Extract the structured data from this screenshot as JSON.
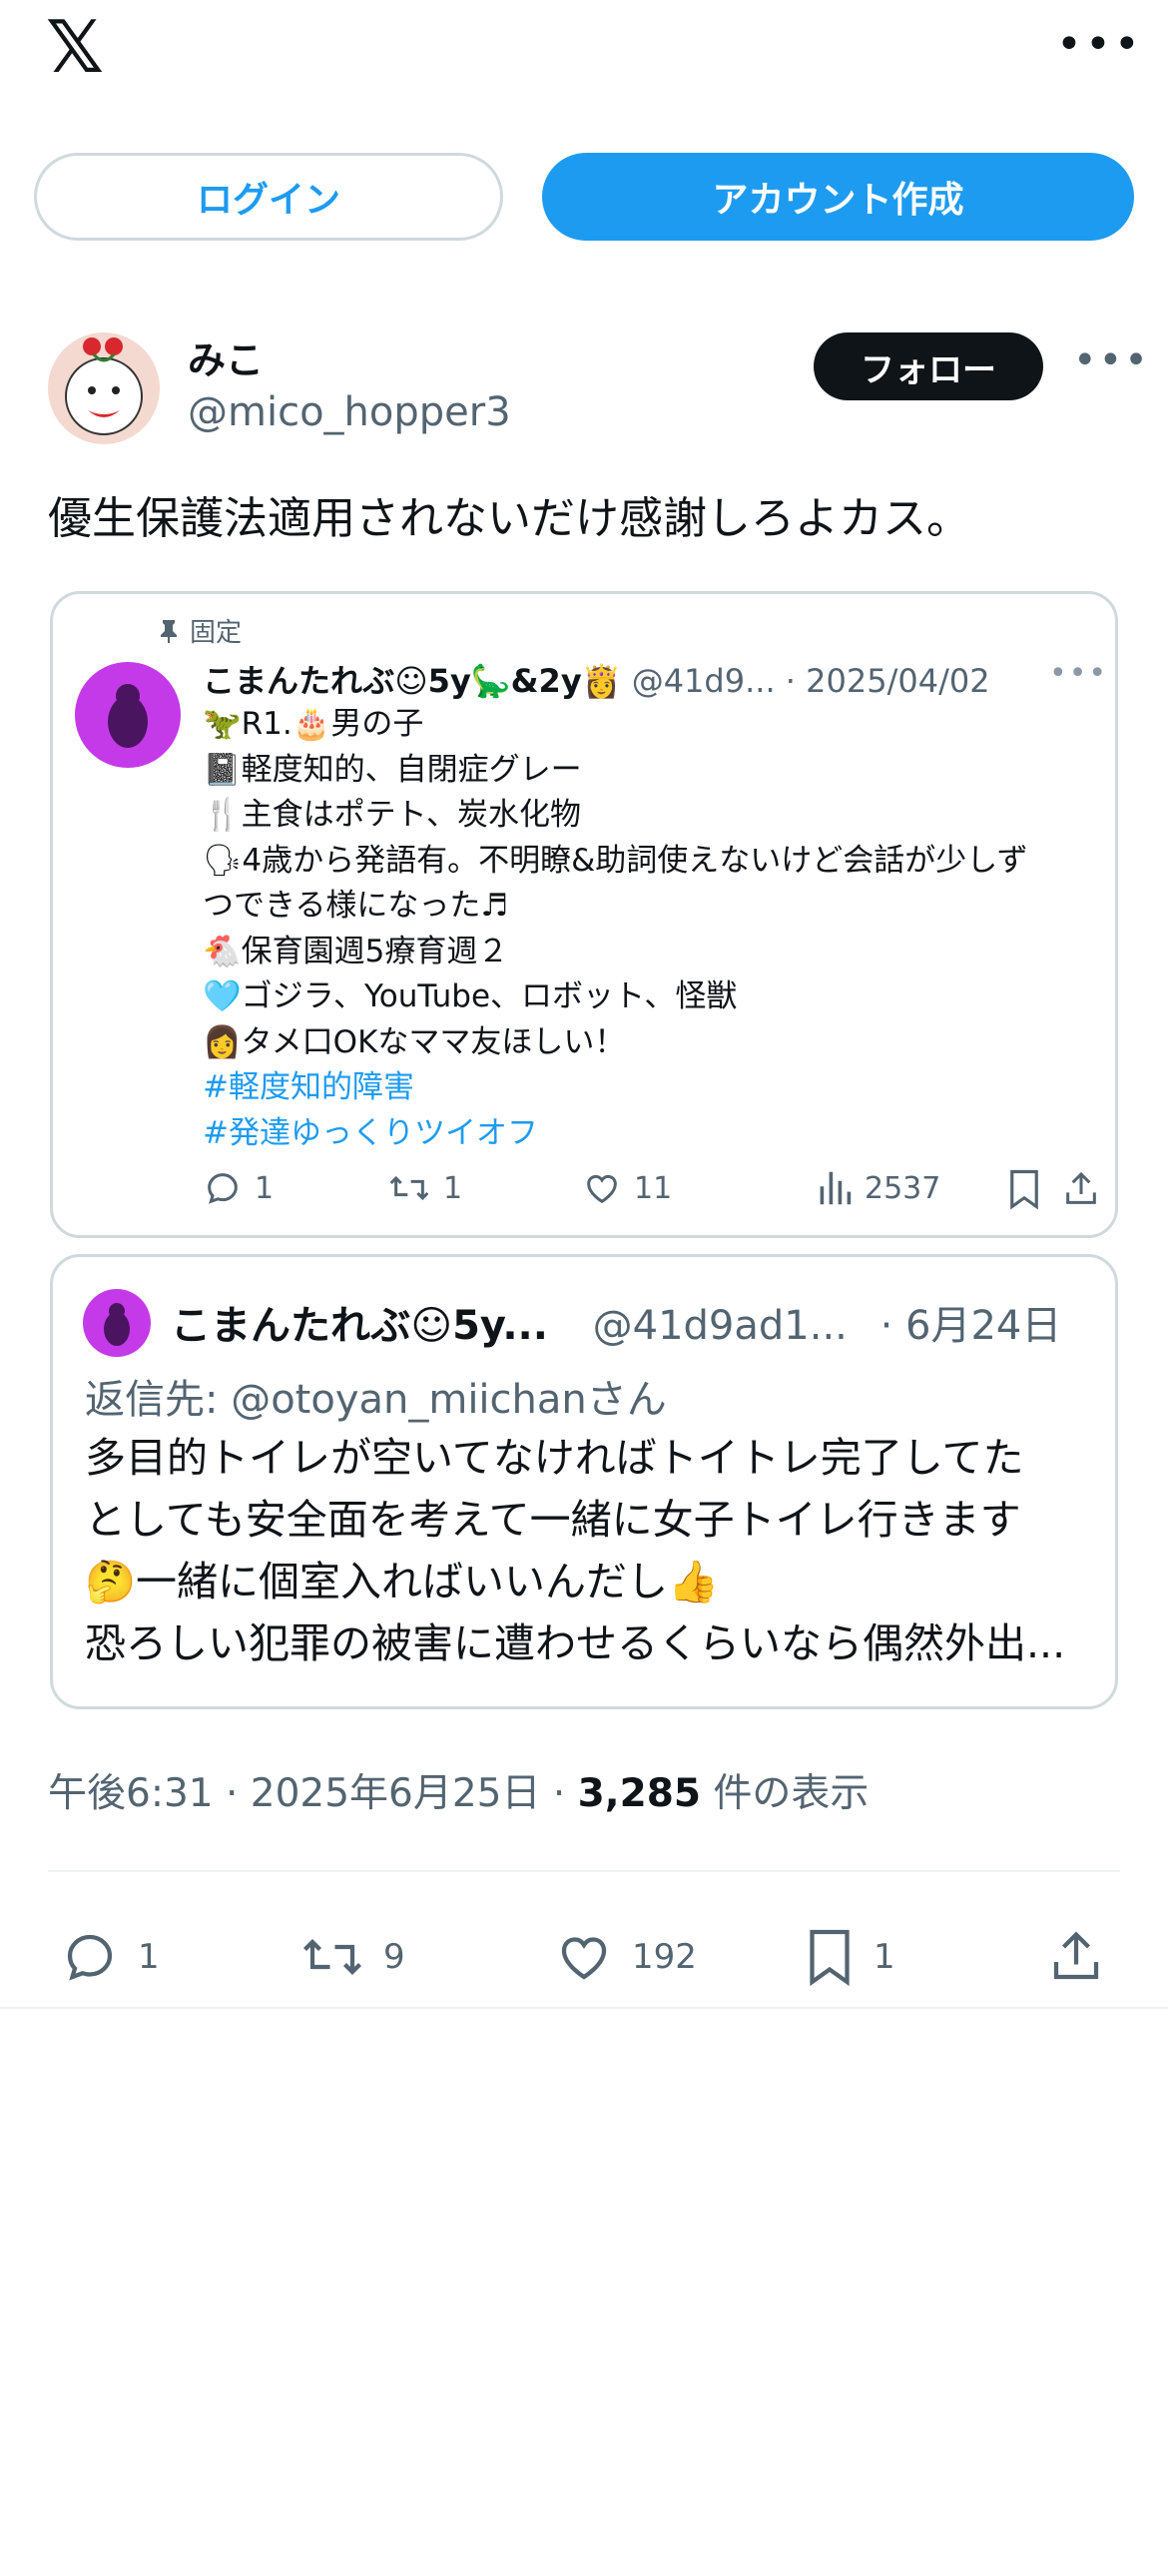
{
  "header": {
    "logo_icon": "x-logo-icon",
    "more_icon": "more-horizontal-icon"
  },
  "auth": {
    "login_label": "ログイン",
    "signup_label": "アカウント作成"
  },
  "author": {
    "name": "みこ",
    "handle": "@mico_hopper3",
    "follow_label": "フォロー"
  },
  "tweet": {
    "text": "優生保護法適用されないだけ感謝しろよカス。"
  },
  "quoted_pinned": {
    "pinned_label": "固定",
    "name": "こまんたれぶ☺5y🦕&2y👸",
    "handle": "@41d9...",
    "date": "· 2025/04/02",
    "lines": [
      "🦖R1.🎂男の子",
      "📓軽度知的、自閉症グレー",
      "🍴主食はポテト、炭水化物",
      "🗣4歳から発語有。不明瞭&助詞使えないけど会話が少しず",
      "つできる様になった♬",
      "🐔保育園週5療育週２",
      "🩵ゴジラ、YouTube、ロボット、怪獣",
      "👩タメ口OKなママ友ほしい！"
    ],
    "hashtags": [
      "#軽度知的障害",
      "#発達ゆっくりツイオフ"
    ],
    "replies": "1",
    "retweets": "1",
    "likes": "11",
    "views": "2537"
  },
  "quoted_reply": {
    "name": "こまんたれぶ☺5y...",
    "handle": "@41d9ad1...",
    "date": "· 6月24日",
    "reply_to": "返信先: @otoyan_miichanさん",
    "lines": [
      "多目的トイレが空いてなければトイトレ完了してた",
      "としても安全面を考えて一緒に女子トイレ行きます",
      "🤔一緒に個室入ればいいんだし👍",
      "恐ろしい犯罪の被害に遭わせるくらいなら偶然外出..."
    ]
  },
  "meta": {
    "time_date": "午後6:31 · 2025年6月25日 · ",
    "views_count": "3,285",
    "views_label": " 件の表示"
  },
  "stats": {
    "replies": "1",
    "retweets": "9",
    "likes": "192",
    "bookmarks": "1"
  },
  "colors": {
    "accent": "#1d9bf0",
    "text": "#0f1419",
    "muted": "#536471",
    "border": "#cfd9de"
  }
}
